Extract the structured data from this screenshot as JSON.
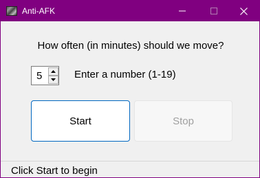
{
  "window": {
    "title": "Anti-AFK",
    "titlebar_color": "#800080",
    "app_icon": "app-icon",
    "controls": {
      "minimize_icon": "minimize-icon",
      "maximize_icon": "maximize-icon",
      "close_icon": "close-icon"
    }
  },
  "main": {
    "prompt": "How often (in minutes) should we move?",
    "interval": {
      "value": "5",
      "up_icon": "chevron-up-icon",
      "down_icon": "chevron-down-icon"
    },
    "hint": "Enter a number (1-19)",
    "start_label": "Start",
    "stop_label": "Stop",
    "start_border_color": "#0067c0",
    "stop_enabled": false
  },
  "status": {
    "text": "Click Start to begin"
  }
}
